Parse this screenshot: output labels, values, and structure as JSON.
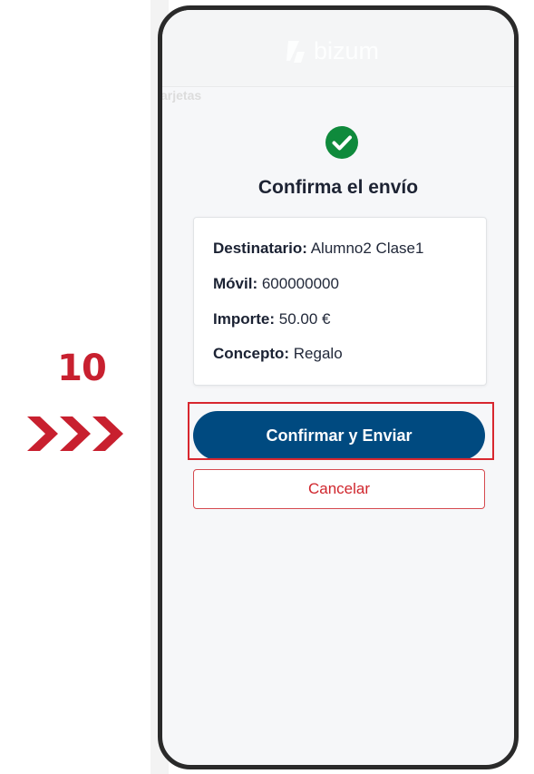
{
  "annotation": {
    "step_number": "10",
    "accent_color": "#c8202f"
  },
  "app": {
    "logo_text": "bizum",
    "background_tab_text": "arjetas"
  },
  "confirmation": {
    "title": "Confirma el envío",
    "status_icon": "check-circle-icon",
    "details": [
      {
        "label": "Destinatario:",
        "value": "Alumno2 Clase1"
      },
      {
        "label": "Móvil:",
        "value": "600000000"
      },
      {
        "label": "Importe:",
        "value": "50.00 €"
      },
      {
        "label": "Concepto:",
        "value": "Regalo"
      }
    ],
    "confirm_label": "Confirmar y Enviar",
    "cancel_label": "Cancelar"
  },
  "colors": {
    "primary": "#004a80",
    "success": "#0f8a3c",
    "danger": "#d0262d"
  }
}
